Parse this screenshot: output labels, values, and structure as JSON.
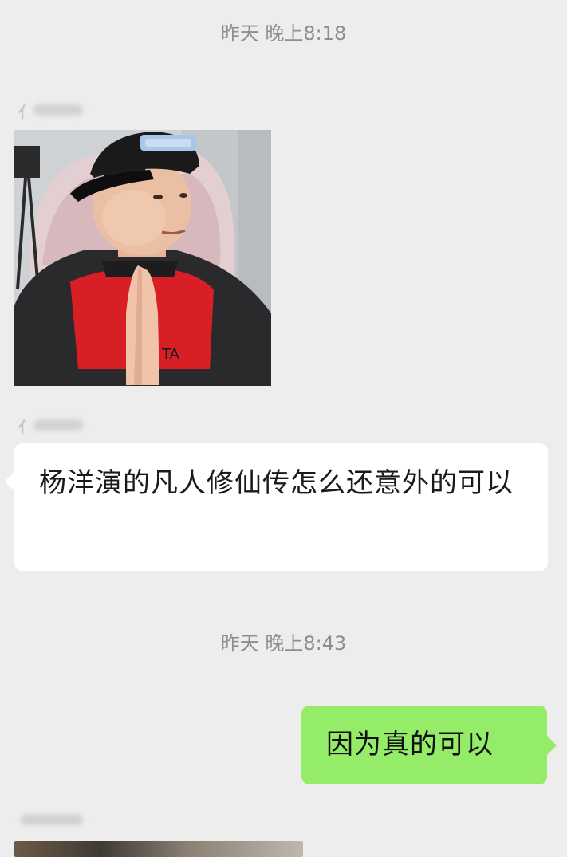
{
  "messages": {
    "timestamp_1": "昨天 晚上8:18",
    "bubble_1_text": "杨洋演的凡人修仙传怎么还意外的可以",
    "timestamp_2": "昨天 晚上8:43",
    "bubble_2_text": "因为真的可以"
  },
  "colors": {
    "background": "#ededed",
    "incoming_bubble": "#ffffff",
    "outgoing_bubble": "#95ec69",
    "timestamp_text": "#8e8e8e"
  }
}
